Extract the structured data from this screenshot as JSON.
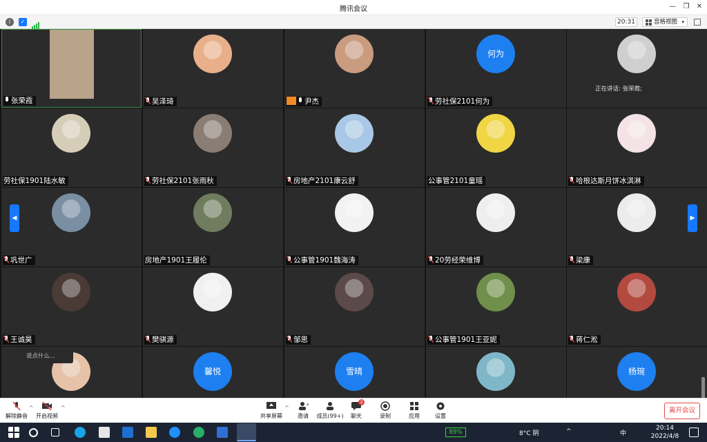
{
  "window": {
    "title": "腾讯会议"
  },
  "status": {
    "timer": "20:31",
    "view_mode": "宫格视图"
  },
  "speaking": "正在讲话: 张荣霞;",
  "chat_placeholder": "说点什么...",
  "participants": [
    {
      "name": "张荣霞",
      "avatar": "video",
      "mic": "on"
    },
    {
      "name": "吴泽琦",
      "avatar": "photo",
      "color": "#e8b08a",
      "mic": "muted"
    },
    {
      "name": "尹杰",
      "avatar": "photo",
      "color": "#c99b7f",
      "mic": "on",
      "host": true
    },
    {
      "name": "劳社保2101何为",
      "avatar": "text",
      "avatar_text": "何为",
      "mic": "muted"
    },
    {
      "name": "",
      "avatar": "photo",
      "color": "#cfcfcf",
      "mic": "muted"
    },
    {
      "name": "劳社保1901陆水敏",
      "avatar": "photo",
      "color": "#d6cdb9",
      "mic": "none"
    },
    {
      "name": "劳社保2101张雨秋",
      "avatar": "photo",
      "color": "#8a7d73",
      "mic": "muted"
    },
    {
      "name": "房地产2101康云舒",
      "avatar": "photo",
      "color": "#a9c7e6",
      "mic": "muted"
    },
    {
      "name": "公事管2101童瑶",
      "avatar": "photo",
      "color": "#f0d545",
      "mic": "none"
    },
    {
      "name": "哈根达斯月饼冰淇淋",
      "avatar": "photo",
      "color": "#f3e2e6",
      "mic": "muted"
    },
    {
      "name": "巩世广",
      "avatar": "photo",
      "color": "#7a8fa3",
      "mic": "muted"
    },
    {
      "name": "房地产1901王履伦",
      "avatar": "photo",
      "color": "#6f7d5e",
      "mic": "none"
    },
    {
      "name": "公事管1901魏海涛",
      "avatar": "photo",
      "color": "#f2f2f2",
      "mic": "muted"
    },
    {
      "name": "20劳经荣维博",
      "avatar": "photo",
      "color": "#eeeeee",
      "mic": "muted"
    },
    {
      "name": "梁康",
      "avatar": "photo",
      "color": "#ececec",
      "mic": "muted"
    },
    {
      "name": "王诚昊",
      "avatar": "photo",
      "color": "#4a3b36",
      "mic": "muted"
    },
    {
      "name": "樊骐源",
      "avatar": "photo",
      "color": "#f0f0f0",
      "mic": "muted"
    },
    {
      "name": "邹思",
      "avatar": "photo",
      "color": "#5c4a4a",
      "mic": "muted"
    },
    {
      "name": "公事管1901王亚妮",
      "avatar": "photo",
      "color": "#6f8f4a",
      "mic": "muted"
    },
    {
      "name": "蒋仁淞",
      "avatar": "photo",
      "color": "#b24a3f",
      "mic": "muted"
    },
    {
      "name": "",
      "avatar": "photo",
      "color": "#e6c2a8",
      "mic": "none"
    },
    {
      "name": "",
      "avatar": "text",
      "avatar_text": "馨悦",
      "mic": "none"
    },
    {
      "name": "",
      "avatar": "text",
      "avatar_text": "雪晴",
      "mic": "none"
    },
    {
      "name": "",
      "avatar": "photo",
      "color": "#7fb7c9",
      "mic": "none"
    },
    {
      "name": "",
      "avatar": "text",
      "avatar_text": "杨琬",
      "mic": "none"
    }
  ],
  "toolbar": {
    "unmute": "解除静音",
    "start_video": "开启视频",
    "share_screen": "共享屏幕",
    "invite": "邀请",
    "members": "成员(99+)",
    "chat": "聊天",
    "chat_badge": "2",
    "record": "录制",
    "apps": "应用",
    "settings": "设置",
    "leave": "离开会议"
  },
  "taskbar": {
    "battery": "89%",
    "weather": "8°C 阴",
    "ime": "中",
    "time": "20:14",
    "date": "2022/4/8"
  },
  "colors": {
    "accent": "#1677ff",
    "leave": "#e54545",
    "tile_bg": "#2b2b2b"
  }
}
